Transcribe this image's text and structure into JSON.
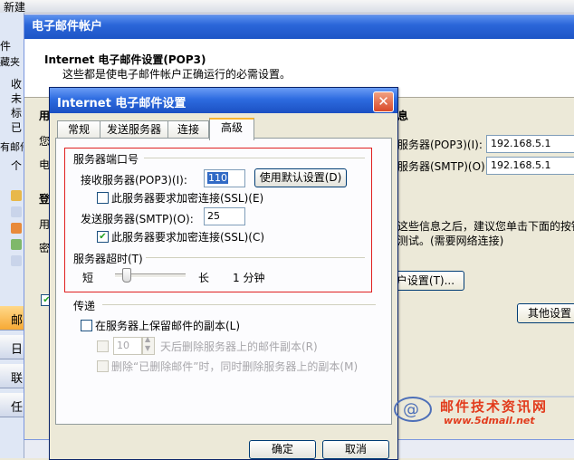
{
  "toolbar": {
    "new_label": "新建"
  },
  "left_pane": {
    "labels": [
      "件",
      "藏夹",
      "收",
      "未",
      "标",
      "已",
      "有邮件",
      "个"
    ],
    "buttons": [
      "邮",
      "日",
      "联",
      "任"
    ]
  },
  "account_window": {
    "title": "电子邮件帐户",
    "heading": "Internet 电子邮件设置(POP3)",
    "description": "这些都是使电子邮件帐户正确运行的必需设置。",
    "side_labels": [
      "用",
      "您",
      "电",
      "登",
      "用",
      "密"
    ],
    "info_label": "息",
    "incoming_label": "服务器(POP3)(I):",
    "incoming_value": "192.168.5.1",
    "outgoing_label": "服务器(SMTP)(O):",
    "outgoing_value": "192.168.5.1",
    "hint_line1": "这些信息之后，建议您单击下面的按钮",
    "hint_line2": "测试。(需要网络连接)",
    "test_button": "户设置(T)...",
    "more_button": "其他设置"
  },
  "dialog": {
    "title": "Internet 电子邮件设置",
    "close_glyph": "✕",
    "tabs": [
      "常规",
      "发送服务器",
      "连接",
      "高级"
    ],
    "active_tab": 3,
    "ports": {
      "group_label": "服务器端口号",
      "incoming_label": "接收服务器(POP3)(I):",
      "incoming_value": "110",
      "default_button": "使用默认设置(D)",
      "ssl_in_label": "此服务器要求加密连接(SSL)(E)",
      "ssl_in_checked": false,
      "outgoing_label": "发送服务器(SMTP)(O):",
      "outgoing_value": "25",
      "ssl_out_label": "此服务器要求加密连接(SSL)(C)",
      "ssl_out_checked": true
    },
    "timeout": {
      "group_label": "服务器超时(T)",
      "short_label": "短",
      "long_label": "长",
      "value": "1 分钟",
      "slider_level": 0.1
    },
    "delivery": {
      "group_label": "传递",
      "keep_copy_label": "在服务器上保留邮件的副本(L)",
      "keep_copy_checked": false,
      "days_value": "10",
      "days_label": "天后删除服务器上的邮件副本(R)",
      "delete_label": "删除“已删除邮件”时，同时删除服务器上的副本(M)"
    },
    "ok_button": "确定",
    "cancel_button": "取消"
  },
  "watermark": {
    "title": "邮件技术资讯网",
    "url": "www.5dmail.net",
    "colors": {
      "title": "#e23b1c",
      "url": "#e23b1c"
    }
  },
  "icons": [
    "close-icon",
    "check-icon",
    "spin-up-icon",
    "spin-down-icon",
    "mail-logo-icon"
  ]
}
